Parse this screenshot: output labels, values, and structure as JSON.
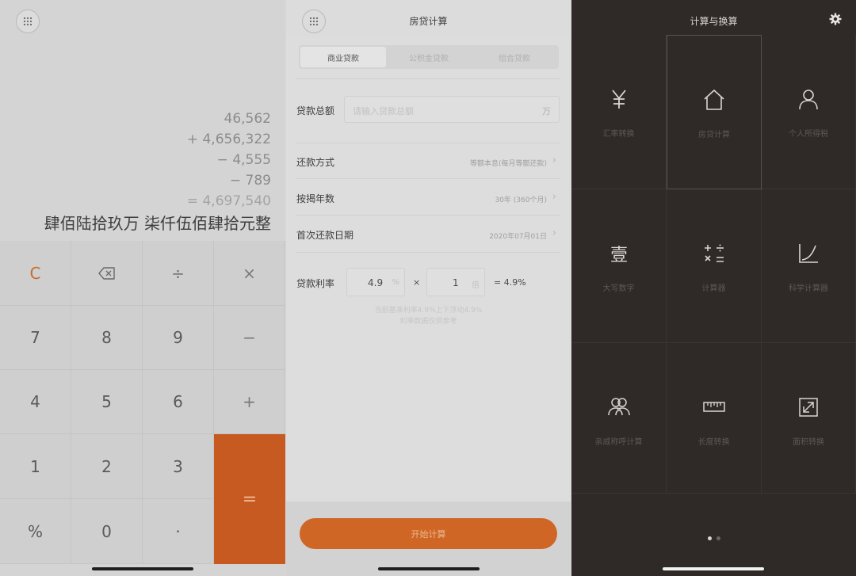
{
  "calculator": {
    "menu_icon": "grid-icon",
    "expression": [
      "46,562",
      "+ 4,656,322",
      "− 4,555",
      "− 789"
    ],
    "result": "= 4,697,540",
    "result_words": "肆佰陆拾玖万 柒仟伍佰肆拾元整",
    "keys": {
      "clear": "C",
      "divide": "÷",
      "multiply": "×",
      "minus": "−",
      "plus": "+",
      "seven": "7",
      "eight": "8",
      "nine": "9",
      "four": "4",
      "five": "5",
      "six": "6",
      "one": "1",
      "two": "2",
      "three": "3",
      "percent": "%",
      "zero": "0",
      "dot": "·",
      "equals": "="
    },
    "accent": "#c75a21"
  },
  "mortgage": {
    "title": "房贷计算",
    "tabs": [
      "商业贷款",
      "公积金贷款",
      "组合贷款"
    ],
    "active_tab": 0,
    "loan_total": {
      "label": "贷款总额",
      "placeholder": "请输入贷款总额",
      "unit": "万"
    },
    "repay_method": {
      "label": "还款方式",
      "value": "等额本息(每月等额还款)"
    },
    "years": {
      "label": "按揭年数",
      "value": "30年 (360个月)"
    },
    "first_date": {
      "label": "首次还款日期",
      "value": "2020年07月01日"
    },
    "rate": {
      "label": "贷款利率",
      "base": "4.9",
      "base_unit": "%",
      "times": "×",
      "multiple": "1",
      "multiple_unit": "倍",
      "result": "= 4.9%"
    },
    "note_line1": "当前基准利率4.9%上下浮动4.9%",
    "note_line2": "利率数据仅供参考",
    "start_button": "开始计算",
    "accent": "#cf6626"
  },
  "tools": {
    "title": "计算与换算",
    "settings_icon": "gear-icon",
    "items": [
      {
        "label": "汇率转换",
        "icon": "yen-icon"
      },
      {
        "label": "房贷计算",
        "icon": "house-icon"
      },
      {
        "label": "个人所得税",
        "icon": "person-icon"
      },
      {
        "label": "大写数字",
        "icon": "capital-number-icon"
      },
      {
        "label": "计算器",
        "icon": "calculator-icon"
      },
      {
        "label": "科学计算器",
        "icon": "curve-icon"
      },
      {
        "label": "亲戚称呼计算",
        "icon": "people-icon"
      },
      {
        "label": "长度转换",
        "icon": "ruler-icon"
      },
      {
        "label": "面积转换",
        "icon": "area-icon"
      }
    ],
    "selected_index": 1,
    "page_indicator": {
      "pages": 2,
      "current": 1
    }
  }
}
